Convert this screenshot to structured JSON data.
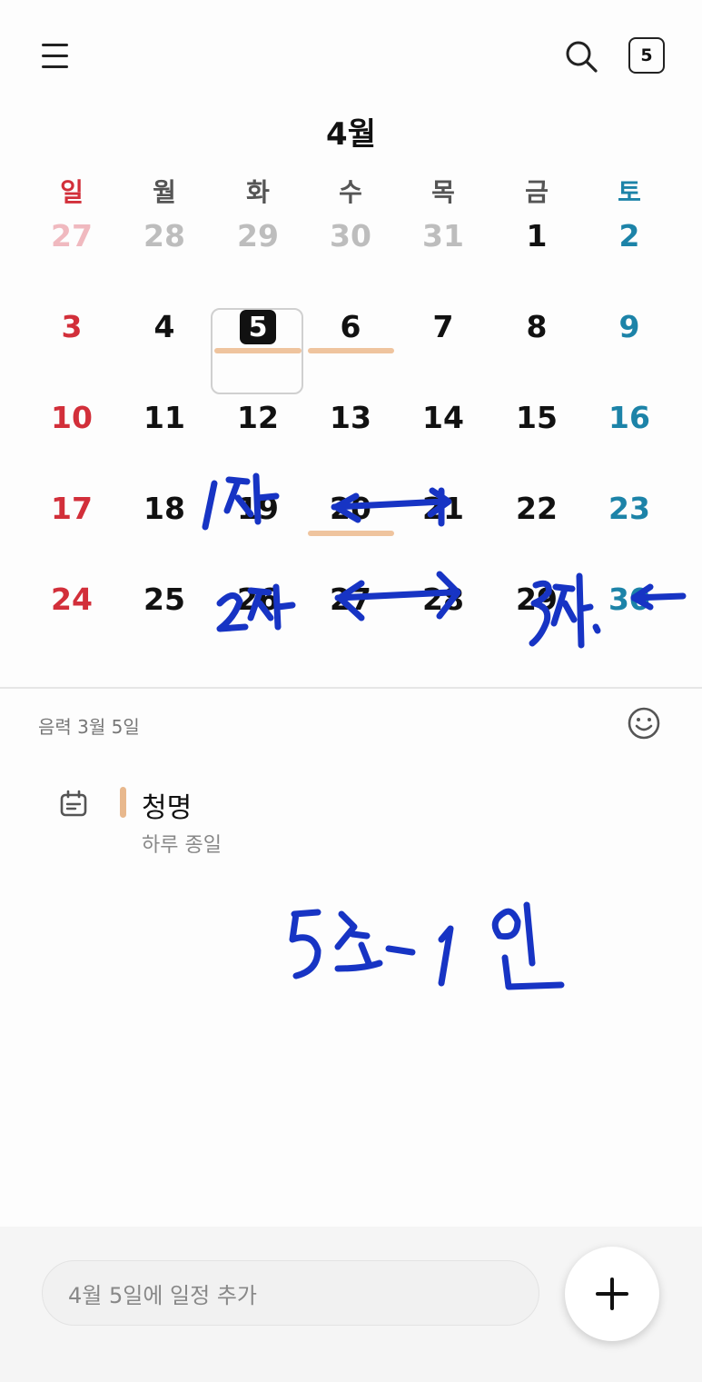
{
  "header": {
    "today_label": "5",
    "month_title": "4월"
  },
  "weekdays": [
    "일",
    "월",
    "화",
    "수",
    "목",
    "금",
    "토"
  ],
  "weeks": [
    [
      "27",
      "28",
      "29",
      "30",
      "31",
      "1",
      "2"
    ],
    [
      "3",
      "4",
      "5",
      "6",
      "7",
      "8",
      "9"
    ],
    [
      "10",
      "11",
      "12",
      "13",
      "14",
      "15",
      "16"
    ],
    [
      "17",
      "18",
      "19",
      "20",
      "21",
      "22",
      "23"
    ],
    [
      "24",
      "25",
      "26",
      "27",
      "28",
      "29",
      "30"
    ]
  ],
  "colors": {
    "sunday": "#d22f3a",
    "saturday": "#1c83a8",
    "prev_month": "#bdbdbd",
    "prev_sunday": "#f0b9bf",
    "event": "#efc49e",
    "ink": "#1734c4"
  },
  "detail": {
    "lunar_date": "음력 3월 5일",
    "event_title": "청명",
    "event_subtitle": "하루 종일"
  },
  "quick_add": {
    "placeholder": "4월 5일에 일정 추가"
  },
  "icons": [
    "menu-icon",
    "search-icon",
    "smile-icon",
    "calendar-event-icon",
    "plus-icon"
  ]
}
